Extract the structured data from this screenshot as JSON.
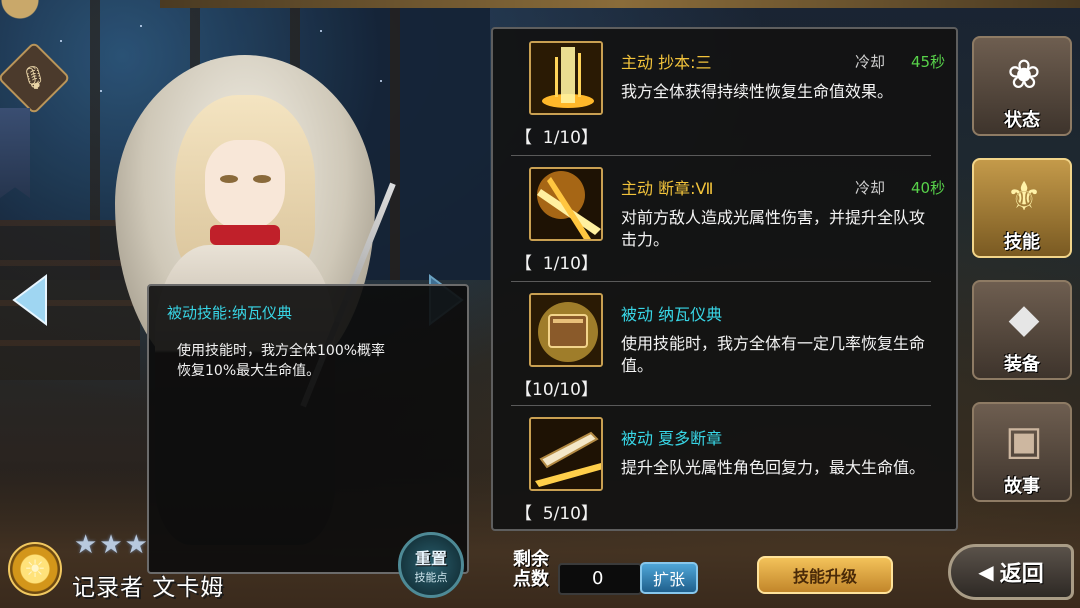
{
  "character": {
    "name": "记录者 文卡姆",
    "star_count": 3,
    "element": "light"
  },
  "tooltip": {
    "title": "被动技能:纳瓦仪典",
    "description_line1": "使用技能时，我方全体100%概率",
    "description_line2": "恢复10%最大生命值。"
  },
  "reset_button": {
    "label_top": "重置",
    "label_bottom": "技能点"
  },
  "skills": [
    {
      "name": "主动 抄本:三",
      "type": "active",
      "cooldown_label": "冷却",
      "cooldown_value": "45秒",
      "description": "我方全体获得持续性恢复生命值效果。",
      "level": "【  1/10】",
      "icon": "light-pillar-icon"
    },
    {
      "name": "主动 断章:Ⅶ",
      "type": "active",
      "cooldown_label": "冷却",
      "cooldown_value": "40秒",
      "description": "对前方敌人造成光属性伤害，并提升全队攻击力。",
      "level": "【  1/10】",
      "icon": "light-burst-icon"
    },
    {
      "name": "被动 纳瓦仪典",
      "type": "passive",
      "description": "使用技能时，我方全体有一定几率恢复生命值。",
      "level": "【10/10】",
      "icon": "book-glow-icon"
    },
    {
      "name": "被动 夏多断章",
      "type": "passive",
      "description": "提升全队光属性角色回复力，最大生命值。",
      "level": "【  5/10】",
      "icon": "open-book-icon"
    }
  ],
  "tabs": [
    {
      "label": "状态",
      "icon": "flower-emblem-icon",
      "active": false
    },
    {
      "label": "技能",
      "icon": "trident-icon",
      "active": true
    },
    {
      "label": "装备",
      "icon": "crystal-icon",
      "active": false
    },
    {
      "label": "故事",
      "icon": "book-icon",
      "active": false
    }
  ],
  "bottom_bar": {
    "points_label_line1": "剩余",
    "points_label_line2": "点数",
    "points_value": "0",
    "expand_label": "扩张",
    "upgrade_label": "技能升级",
    "back_label": "返回"
  },
  "colors": {
    "active_skill": "#f2c33b",
    "passive_skill": "#38d6e6",
    "cooldown": "#58d24a",
    "gold_accent": "#c9a052"
  }
}
